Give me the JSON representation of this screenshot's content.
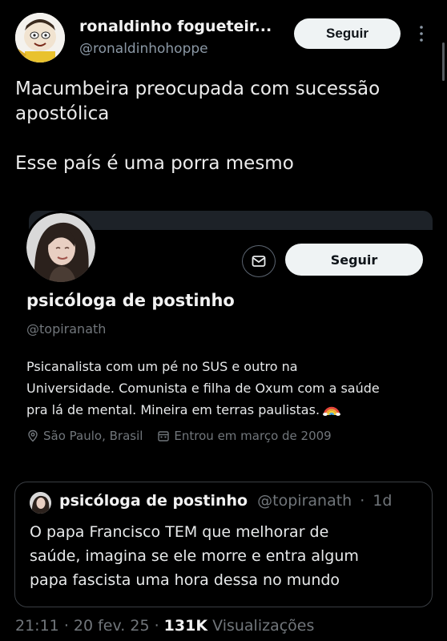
{
  "author": {
    "name": "ronaldinho fogueteir...",
    "handle": "@ronaldinhohoppe",
    "follow_label": "Seguir"
  },
  "tweet": {
    "lines": [
      "Macumbeira preocupada com sucessão",
      "apostólica",
      "Esse país é uma porra mesmo"
    ]
  },
  "profile_card": {
    "name": "psicóloga de postinho",
    "handle": "@topiranath",
    "follow_label": "Seguir",
    "bio_lines": [
      "Psicanalista com um pé no SUS e outro na",
      "Universidade. Comunista e filha de Oxum com a saúde",
      "pra lá de mental. Mineira em terras paulistas."
    ],
    "bio_emoji": "rainbow-emoji",
    "location": "São Paulo, Brasil",
    "joined": "Entrou em março de 2009"
  },
  "quote": {
    "name": "psicóloga de postinho",
    "handle": "@topiranath",
    "separator": "·",
    "time": "1d",
    "lines": [
      "O papa Francisco TEM que melhorar de",
      "saúde, imagina se ele morre e entra algum",
      "papa fascista uma hora dessa no mundo"
    ]
  },
  "footer": {
    "time": "21:11",
    "date": "20 fev. 25",
    "views_count": "131K",
    "views_label": "Visualizações",
    "separator": "·"
  },
  "colors": {
    "background": "#000000",
    "text": "#e7e9ea",
    "secondary_text": "#71767b",
    "button_bg": "#eff3f4"
  }
}
